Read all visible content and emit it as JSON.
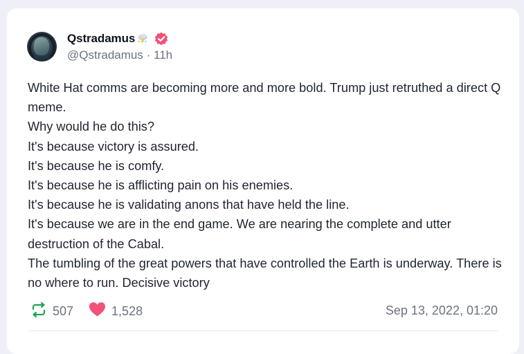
{
  "post": {
    "author": {
      "display_name": "Qstradamus",
      "name_emoji": "cloud-lightning-emoji",
      "verified_icon": "verified-badge-icon",
      "handle": "@Qstradamus",
      "separator": "·",
      "age": "11h",
      "avatar_icon": "hooded-figure-avatar"
    },
    "lines": [
      "White Hat comms are becoming more and more bold. Trump just retruthed a direct Q meme.",
      "Why would he do this?",
      "It's because victory is assured.",
      "It's because he is comfy.",
      "It's because he is afflicting pain on his enemies.",
      "It's because he is validating anons that have held the line.",
      "It's because we are in the end game. We are nearing the complete and utter destruction of the Cabal.",
      "The tumbling of the great powers that have controlled the Earth is underway. There is no where to run. Decisive victory"
    ],
    "actions": {
      "repost_icon": "repost-icon",
      "repost_count": "507",
      "like_icon": "heart-icon",
      "like_count": "1,528"
    },
    "timestamp": "Sep 13, 2022, 01:20",
    "colors": {
      "verified": "#f0527a",
      "repost": "#22a356",
      "like": "#f0527a"
    }
  }
}
